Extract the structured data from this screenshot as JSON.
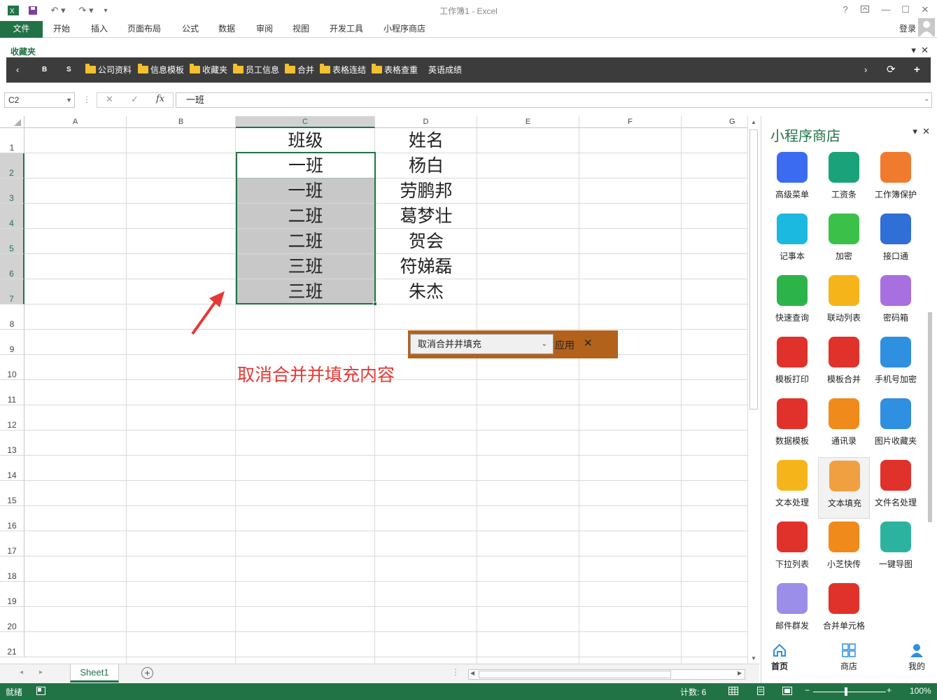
{
  "window": {
    "title": "工作簿1 - Excel",
    "help": "?",
    "login": "登录"
  },
  "ribbon": {
    "tabs": [
      "文件",
      "开始",
      "插入",
      "页面布局",
      "公式",
      "数据",
      "审阅",
      "视图",
      "开发工具",
      "小程序商店"
    ]
  },
  "favorites": {
    "title": "收藏夹",
    "nav_b": "B",
    "nav_s": "S",
    "folders": [
      "公司资料",
      "信息模板",
      "收藏夹",
      "员工信息",
      "合并",
      "表格连结",
      "表格查重"
    ],
    "link": "英语成绩"
  },
  "formula": {
    "namebox": "C2",
    "value": "一班"
  },
  "columns": [
    "A",
    "B",
    "C",
    "D",
    "E",
    "F",
    "G"
  ],
  "rows": [
    "1",
    "2",
    "3",
    "4",
    "5",
    "6",
    "7",
    "8",
    "9",
    "10",
    "11",
    "12",
    "13",
    "14",
    "15",
    "16",
    "17",
    "18",
    "19",
    "20",
    "21"
  ],
  "table": {
    "class_header": "班级",
    "name_header": "姓名",
    "classes": [
      "一班",
      "一班",
      "二班",
      "二班",
      "三班",
      "三班"
    ],
    "names": [
      "杨白",
      "劳鹏邦",
      "葛梦壮",
      "贺会",
      "符娣磊",
      "朱杰"
    ]
  },
  "annotation": "取消合并并填充内容",
  "tool_panel": {
    "selected": "取消合并并填充",
    "apply": "应用",
    "close": "✕"
  },
  "sheets": [
    "Sheet1"
  ],
  "status": {
    "mode": "就绪",
    "count": "计数: 6",
    "zoom": "100%"
  },
  "store": {
    "title": "小程序商店",
    "apps": [
      {
        "label": "高级菜单",
        "icon": "menu-icon",
        "color": "#3a6bf0"
      },
      {
        "label": "工资条",
        "icon": "payslip-icon",
        "color": "#1aa37a"
      },
      {
        "label": "工作簿保护",
        "icon": "shield-icon",
        "color": "#f07a2e"
      },
      {
        "label": "记事本",
        "icon": "notebook-icon",
        "color": "#1bb8e0"
      },
      {
        "label": "加密",
        "icon": "lock-icon",
        "color": "#3bc14a"
      },
      {
        "label": "接口通",
        "icon": "monitor-icon",
        "color": "#2f6fd6"
      },
      {
        "label": "快速查询",
        "icon": "search-icon",
        "color": "#2cb34a"
      },
      {
        "label": "联动列表",
        "icon": "list-icon",
        "color": "#f5b51a"
      },
      {
        "label": "密码箱",
        "icon": "key-icon",
        "color": "#a86fe0"
      },
      {
        "label": "模板打印",
        "icon": "printer-icon",
        "color": "#e0322a"
      },
      {
        "label": "模板合并",
        "icon": "merge-icon",
        "color": "#e0322a"
      },
      {
        "label": "手机号加密",
        "icon": "phone-icon",
        "color": "#2f8fe0"
      },
      {
        "label": "数据模板",
        "icon": "cube-icon",
        "color": "#e0322a"
      },
      {
        "label": "通讯录",
        "icon": "contacts-icon",
        "color": "#f08a1a"
      },
      {
        "label": "图片收藏夹",
        "icon": "picture-icon",
        "color": "#2f8fe0"
      },
      {
        "label": "文本处理",
        "icon": "text-icon",
        "color": "#f5b51a"
      },
      {
        "label": "文本填充",
        "icon": "document-icon",
        "color": "#f0a040"
      },
      {
        "label": "文件名处理",
        "icon": "files-icon",
        "color": "#e0322a"
      },
      {
        "label": "下拉列表",
        "icon": "dropdown-icon",
        "color": "#e0322a"
      },
      {
        "label": "小芝快传",
        "icon": "broadcast-icon",
        "color": "#f08a1a"
      },
      {
        "label": "一键导图",
        "icon": "export-image-icon",
        "color": "#2cb3a0"
      },
      {
        "label": "邮件群发",
        "icon": "mail-icon",
        "color": "#9b8ee8"
      },
      {
        "label": "合并单元格",
        "icon": "grid-icon",
        "color": "#e0322a"
      }
    ],
    "nav": [
      "首页",
      "商店",
      "我的"
    ]
  },
  "colors": {
    "accent": "#217346",
    "tool_panel": "#b3621c",
    "annotation": "#e53935",
    "selection_fill": "#c8c8c8"
  }
}
